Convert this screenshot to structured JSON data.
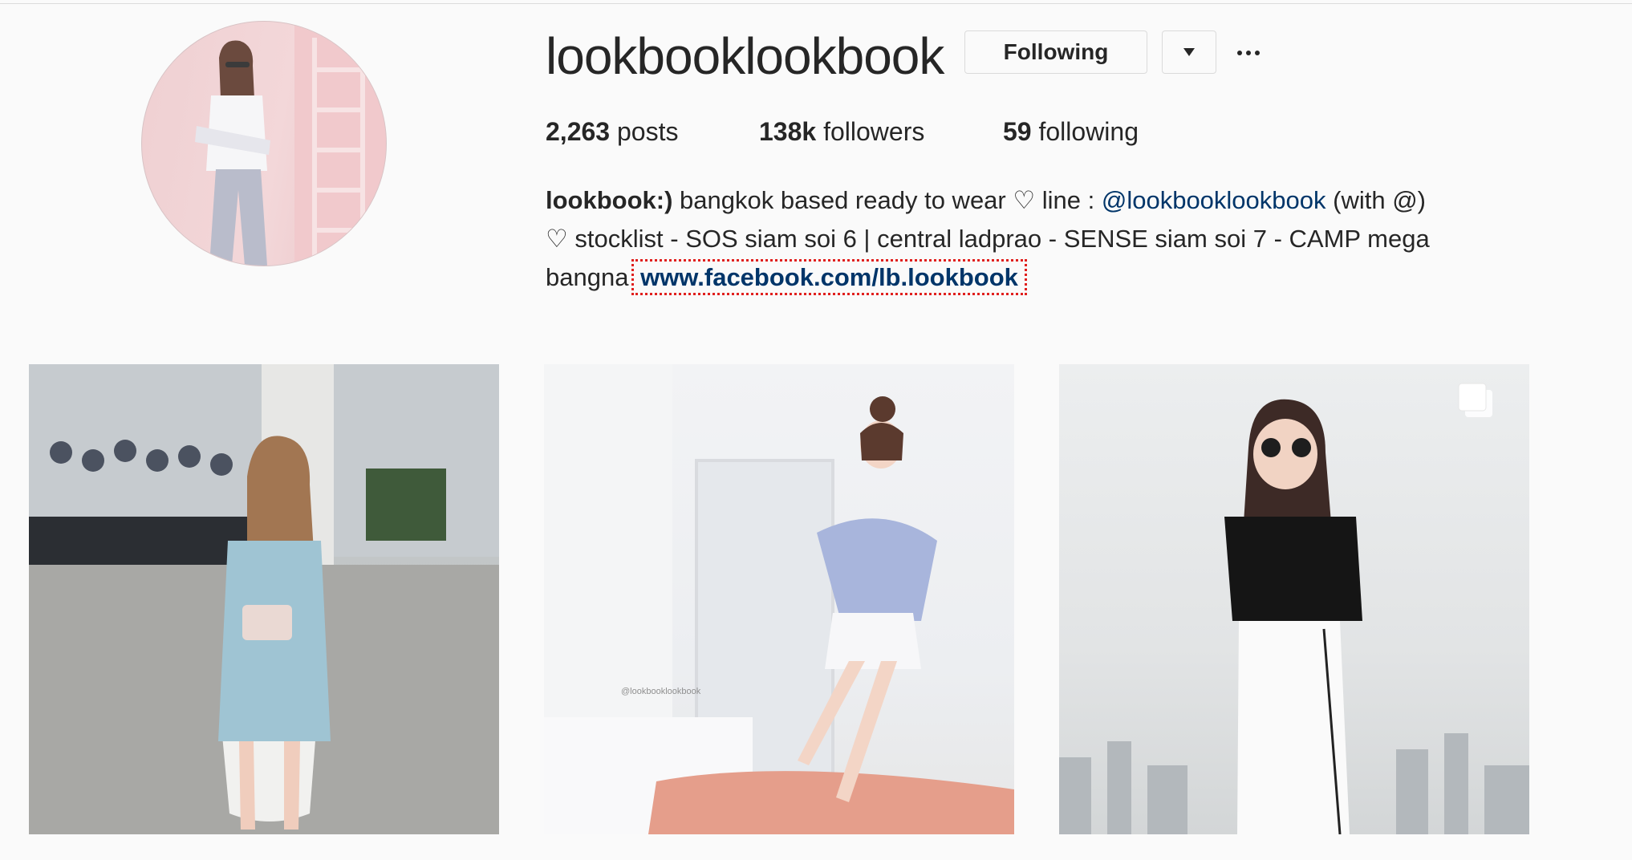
{
  "profile": {
    "username": "lookbooklookbook",
    "following_label": "Following",
    "stats": {
      "posts_count": "2,263",
      "posts_label": "posts",
      "followers_count": "138k",
      "followers_label": "followers",
      "following_count": "59",
      "following_label": "following"
    },
    "bio": {
      "name": "lookbook:)",
      "line1_text": " bangkok based ready to wear ♡ line : ",
      "mention": "@lookbooklookbook",
      "line1_tail": " (with @)",
      "line2": "♡ stocklist - SOS siam soi 6 | central ladprao - SENSE siam soi 7 - CAMP mega",
      "line3_prefix": "bangna",
      "link": "www.facebook.com/lb.lookbook"
    }
  },
  "posts": [
    {
      "image_desc": "woman in light blue romper with pink bag at mall",
      "multi_photo": false
    },
    {
      "image_desc": "woman in off-shoulder blue top in white studio",
      "multi_photo": false,
      "watermark": "@lookbooklookbook"
    },
    {
      "image_desc": "woman in black top and white pants with sunglasses",
      "multi_photo": true
    }
  ],
  "icons": {
    "dropdown": "caret-down-icon",
    "more": "more-options-icon",
    "multi_photo": "gallery-icon"
  },
  "colors": {
    "link": "#003569",
    "highlight_outline": "#e0201e",
    "background": "#fafafa"
  }
}
